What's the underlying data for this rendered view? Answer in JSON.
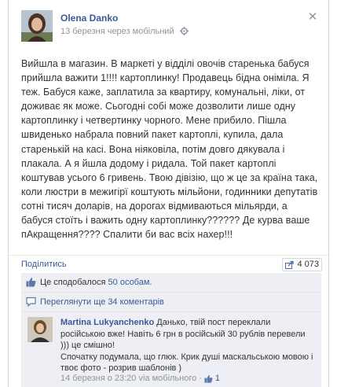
{
  "post": {
    "author": "Olena Danko",
    "timestamp": "13 березня через мобільний",
    "close_symbol": "✕",
    "paragraph": "Вийшла в магазин. В маркеті у відділі овочів старенька бабуся прийшла важити 1!!!! картоплинку! Продавець бідна оніміла. Я теж. Бабуся каже, заплатила за квартиру, комунальні, ліки, от доживає як може. Сьогодні собі може дозволити лише одну картоплинку і четвертинку чорного. Мене прибило. Пішла швиденько набрала повний пакет картоплі, купила, дала старенькій на касі. Вона ніяковіла, потім довго дякувала і плакала. А я йшла додому і ридала. Той пакет картоплі коштував усього 6 гривень. Твою дівізію, що ж це за країна така, коли люстри в межигірї коштують мільйони, годинники депутатів сотні тисяч доларів, на дорогах відмиваються мільярди, а бабуся стоїть і важить одну картоплинку?????? Де курва ваше пАкращення???? Спалити би вас всіх нахер!!!"
  },
  "actions": {
    "share_label": "Поділитись",
    "share_count": "4 073"
  },
  "likes": {
    "prefix": "Це сподобалося",
    "count_link": "50 особам",
    "suffix": "."
  },
  "more_comments": {
    "label": "Переглянути ще 34 коментарів"
  },
  "comment": {
    "author": "Martina Lukyanchenko",
    "text_1": "Данько, твій пост переклали російською вже! Навіть 6 грн в російській 30 рублів перевели ))) це смішно!",
    "text_2": "Спочатку подумала, що глюк. Крик душі маскальською мовою і твоє фото - розрив шаблонів )",
    "date": "14 березня о 23:20 via мобільного",
    "separator": "·",
    "like_count": "1"
  },
  "icons": {
    "gear": "gear-icon",
    "like": "thumbs-up-icon",
    "comments": "comment-bubble-icon",
    "share": "share-icon"
  },
  "colors": {
    "link": "#3b5998",
    "muted": "#90949c",
    "feedback_bg": "#edeff4"
  }
}
